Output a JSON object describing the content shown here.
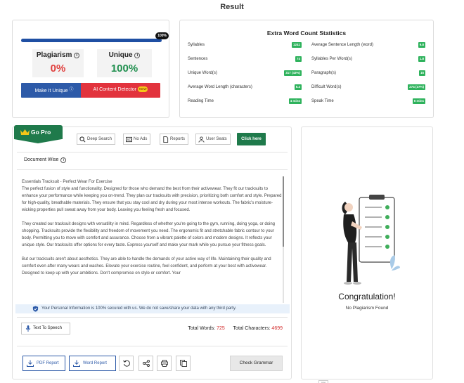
{
  "page": {
    "title": "Result"
  },
  "result": {
    "progress_label": "100%",
    "progress_value": 100,
    "plagiarism_label": "Plagiarism",
    "plagiarism_value": "0%",
    "unique_label": "Unique",
    "unique_value": "100%",
    "make_unique_label": "Make It Unique",
    "ai_detector_label": "AI Content Detector",
    "new_badge": "NEW",
    "colors": {
      "plagiarism": "#e0403e",
      "unique": "#1f8f4e"
    }
  },
  "extra_stats": {
    "title": "Extra Word Count Statistics",
    "left": [
      {
        "label": "Syllables",
        "value": "1241"
      },
      {
        "label": "Sentences",
        "value": "74"
      },
      {
        "label": "Unique Word(s)",
        "value": "317 (43%)"
      },
      {
        "label": "Average Word Length (characters)",
        "value": "5.4"
      },
      {
        "label": "Reading Time",
        "value": "4 mins"
      }
    ],
    "right": [
      {
        "label": "Average Sentence Length (word)",
        "value": "9.8"
      },
      {
        "label": "Syllables Per Word(s)",
        "value": "1.8"
      },
      {
        "label": "Paragraph(s)",
        "value": "15"
      },
      {
        "label": "Difficult Word(s)",
        "value": "274 (37%)"
      },
      {
        "label": "Speak Time",
        "value": "6 mins"
      }
    ]
  },
  "toolbar": {
    "go_pro": "Go Pro",
    "deep_search": "Deep Search",
    "no_ads": "No Ads",
    "reports": "Reports",
    "user_seats": "User Seats",
    "click_here": "Click here"
  },
  "document": {
    "label": "Document Wise",
    "paragraphs": [
      "Essentials Tracksuit - Perfect Wear For Exercise\nThe perfect fusion of style and functionality. Designed for those who demand the best from their activewear. They fit our tracksuits to enhance your performance while keeping you on-trend. They plan our tracksuits with precision, prioritizing both comfort and style. Prepared for high-quality, breathable materials. They ensure that you stay cool and dry during your most intense workouts. The fabric's moisture-wicking properties pull sweat away from your body. Leaving you feeling fresh and focused.",
      "They created our tracksuit designs with versatility in mind. Regardless of whether you're going to the gym, running, doing yoga, or doing shopping. Tracksuits provide the flexibility and freedom of movement you need. The ergonomic fit and stretchable fabric contour to your body. Permitting you to move with comfort and assurance. Choose from a vibrant palette of colors and modern designs. It reflects your unique style. Our tracksuits offer options for every taste. Express yourself and make your mark while you pursue your fitness goals.",
      "But our tracksuits aren't about aesthetics. They are able to handle the demands of your active way of life. Maintaining their quality and comfort even after many wears and washes. Elevate your exercise routine, feel confident, and perform at your best with activewear. Designed to keep up with your ambitions. Don't compromise on style or comfort. Your"
    ],
    "secure_notice": "Your Personal Information is 100% secured with us. We do not save/share your data with any third party."
  },
  "footer": {
    "tts": "Text To Speech",
    "total_words_label": "Total Words:",
    "total_words": "725",
    "total_chars_label": "Total Characters:",
    "total_chars": "4699",
    "pdf_report": "PDF Report",
    "word_report": "Word Report",
    "check_grammar": "Check Grammar"
  },
  "congrats": {
    "title": "Congratulation!",
    "subtitle": "No Plagiarism Found"
  },
  "tiny_tag": "cose"
}
